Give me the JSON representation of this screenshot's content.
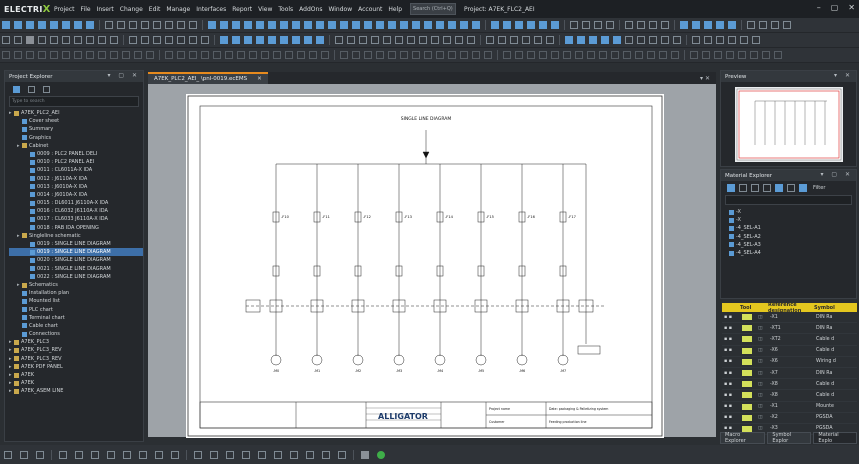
{
  "app": {
    "logo_text": "ELECTRI",
    "logo_x": "X",
    "menu": [
      "Project",
      "File",
      "Insert",
      "Change",
      "Edit",
      "Manage",
      "Interfaces",
      "Report",
      "View",
      "Tools",
      "AddOns",
      "Window",
      "Account",
      "Help"
    ],
    "search_placeholder": "Search (Ctrl+Q)",
    "project_title": "Project: A7EK_FLC2_AEI"
  },
  "project_explorer": {
    "title": "Project Explorer",
    "search_placeholder": "Type to search",
    "items": [
      {
        "label": "A7EK_PLC2_AEI",
        "level": 0,
        "icon": "folder"
      },
      {
        "label": "Cover sheet",
        "level": 1,
        "icon": "page"
      },
      {
        "label": "Summary",
        "level": 1,
        "icon": "page"
      },
      {
        "label": "Graphics",
        "level": 1,
        "icon": "page"
      },
      {
        "label": "Cabinet",
        "level": 1,
        "icon": "folder"
      },
      {
        "label": "0009 : PLC2 PANEL DELI",
        "level": 2,
        "icon": "page"
      },
      {
        "label": "0010 : PLC2 PANEL AEI",
        "level": 2,
        "icon": "page"
      },
      {
        "label": "0011 : CL6011A-X IDA",
        "level": 2,
        "icon": "page"
      },
      {
        "label": "0012 : J6110A-X IDA",
        "level": 2,
        "icon": "page"
      },
      {
        "label": "0013 : J6010A-X IDA",
        "level": 2,
        "icon": "page"
      },
      {
        "label": "0014 : J6010A-X IDA",
        "level": 2,
        "icon": "page"
      },
      {
        "label": "0015 : DL6011 J6110A-X IDA",
        "level": 2,
        "icon": "page"
      },
      {
        "label": "0016 : CL6032 J6110A-X IDA",
        "level": 2,
        "icon": "page"
      },
      {
        "label": "0017 : CL6033 J6110A-X IDA",
        "level": 2,
        "icon": "page"
      },
      {
        "label": "0018 : PAB IDA OPENING",
        "level": 2,
        "icon": "page"
      },
      {
        "label": "Singleline schematic",
        "level": 1,
        "icon": "folder"
      },
      {
        "label": "0019 : SINGLE LINE DIAGRAM",
        "level": 2,
        "icon": "page"
      },
      {
        "label": "0019 : SINGLE LINE DIAGRAM",
        "level": 2,
        "icon": "page",
        "selected": true
      },
      {
        "label": "0020 : SINGLE LINE DIAGRAM",
        "level": 2,
        "icon": "page"
      },
      {
        "label": "0021 : SINGLE LINE DIAGRAM",
        "level": 2,
        "icon": "page"
      },
      {
        "label": "0022 : SINGLE LINE DIAGRAM",
        "level": 2,
        "icon": "page"
      },
      {
        "label": "Schematics",
        "level": 1,
        "icon": "folder"
      },
      {
        "label": "Installation plan",
        "level": 1,
        "icon": "page"
      },
      {
        "label": "Mounted list",
        "level": 1,
        "icon": "page"
      },
      {
        "label": "PLC chart",
        "level": 1,
        "icon": "page"
      },
      {
        "label": "Terminal chart",
        "level": 1,
        "icon": "page"
      },
      {
        "label": "Cable chart",
        "level": 1,
        "icon": "page"
      },
      {
        "label": "Connections",
        "level": 1,
        "icon": "page"
      },
      {
        "label": "A7EK_PLC3",
        "level": 0,
        "icon": "folder"
      },
      {
        "label": "A7EK_PLC3_REV",
        "level": 0,
        "icon": "folder"
      },
      {
        "label": "A7EK_PLC3_REV",
        "level": 0,
        "icon": "folder"
      },
      {
        "label": "A7EK PDF PANEL",
        "level": 0,
        "icon": "folder"
      },
      {
        "label": "A7EK",
        "level": 0,
        "icon": "folder"
      },
      {
        "label": "A7EK",
        "level": 0,
        "icon": "folder"
      },
      {
        "label": "A7EK_ASEM LINE",
        "level": 0,
        "icon": "folder"
      }
    ]
  },
  "document": {
    "tab_label": "A7EK_PLC2_AEI_ \\pnl-0019.ecEMS",
    "sheet_heading": "SINGLE LINE DIAGRAM",
    "breakers": [
      "-F10",
      "-F11",
      "-F12",
      "-F13",
      "-F14",
      "-F15",
      "-F16",
      "-F17"
    ],
    "motors": [
      "-M0",
      "-M1",
      "-M2",
      "-M3",
      "-M4",
      "-M5",
      "-M6",
      "-M7"
    ],
    "title_logo": "ALLIGATOR",
    "title_desc1": "Date: packaging & Palletizing system",
    "title_desc2": "Feeding production line",
    "title_field1": "Project name",
    "title_field2": "Customer"
  },
  "preview": {
    "title": "Preview"
  },
  "material": {
    "title": "Material Explorer",
    "filter_label": "Filter",
    "items": [
      "-X",
      "-X",
      "-4_SEL-A1",
      "-4_SEL-A2",
      "-4_SEL-A3",
      "-4_SEL-A4"
    ]
  },
  "variables": {
    "headers": [
      "",
      "Tool",
      "",
      "Reference designation",
      "Symbol"
    ],
    "rows": [
      {
        "id": "-X1",
        "sym": "DIN Ra"
      },
      {
        "id": "-XT1",
        "sym": "DIN Ra"
      },
      {
        "id": "-XT2",
        "sym": "Cable d"
      },
      {
        "id": "-X6",
        "sym": "Cable d"
      },
      {
        "id": "-X6",
        "sym": "Wiring d"
      },
      {
        "id": "-X7",
        "sym": "DIN Ra"
      },
      {
        "id": "-X8",
        "sym": "Cable d"
      },
      {
        "id": "-X8",
        "sym": "Cable d"
      },
      {
        "id": "-X1",
        "sym": "Mounte"
      },
      {
        "id": "-X2",
        "sym": "PGSDA"
      },
      {
        "id": "-X3",
        "sym": "PGSDA"
      }
    ]
  },
  "bottom_tabs": [
    "Macro Explorer",
    "Symbol Explor",
    "Material Explo"
  ]
}
